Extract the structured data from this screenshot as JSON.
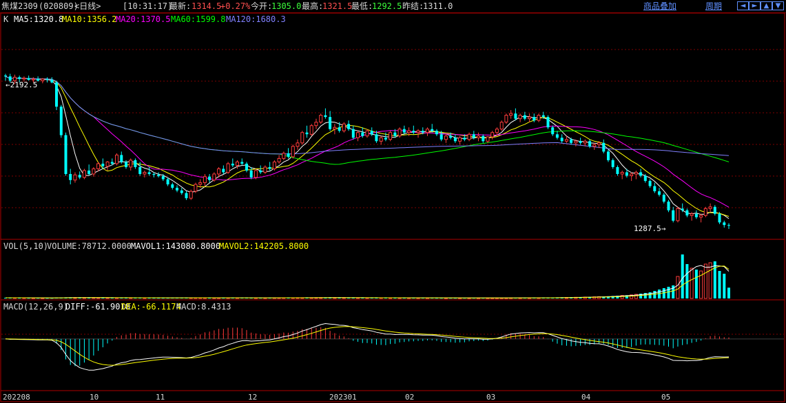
{
  "header": {
    "contract": "焦煤2309",
    "code": "(020809)",
    "period": "<日线>",
    "time": "[10:31:17]",
    "latest_label": "最新:",
    "latest": "1314.5",
    "change": "+0.27%",
    "open_label": "今开:",
    "open": "1305.0",
    "high_label": "最高:",
    "high": "1321.5",
    "low_label": "最低:",
    "low": "1292.5",
    "prev_close_label": "昨结:",
    "prev_close": "1311.0",
    "overlay_link": "商品叠加",
    "cycle_link": "周期",
    "nav_buttons": [
      "◄",
      "►",
      "▲",
      "▼"
    ]
  },
  "main_panel": {
    "type_label": "K",
    "ma": [
      {
        "label": "MA5:1320.8",
        "color": "#ffffff"
      },
      {
        "label": "MA10:1356.2",
        "color": "#ffff00"
      },
      {
        "label": "MA20:1370.5",
        "color": "#ff00ff"
      },
      {
        "label": "MA60:1599.8",
        "color": "#00ff00"
      },
      {
        "label": "MA120:1680.3",
        "color": "#8080ff"
      }
    ],
    "high_marker": "←2192.5",
    "low_marker": "1287.5→"
  },
  "vol_panel": {
    "title": "VOL(5,10)",
    "volume": "VOLUME:78712.0000",
    "mavol1": "MAVOL1:143080.8000",
    "mavol2": "MAVOL2:142205.8000"
  },
  "macd_panel": {
    "title": "MACD(12,26,9)",
    "diff": "DIFF:-61.9018",
    "dea": "DEA:-66.1174",
    "macd": "MACD:8.4313"
  },
  "x_axis_labels": [
    "202208",
    "10",
    "11",
    "12",
    "202301",
    "02",
    "03",
    "04",
    "05"
  ],
  "colors": {
    "up": "#ff3c3c",
    "down": "#00ffff",
    "grid": "#800000",
    "axis": "#b00000"
  },
  "chart_data": {
    "type": "candlestick",
    "price_range": [
      1240,
      2450
    ],
    "vol_range": [
      0,
      330000
    ],
    "macd_range": [
      -245,
      130
    ],
    "candles": [
      [
        2180,
        2190,
        2150,
        2175,
        5000
      ],
      [
        2175,
        2190,
        2140,
        2150,
        5200
      ],
      [
        2150,
        2185,
        2130,
        2170,
        4800
      ],
      [
        2170,
        2180,
        2140,
        2160,
        4500
      ],
      [
        2160,
        2175,
        2145,
        2165,
        4300
      ],
      [
        2165,
        2180,
        2150,
        2155,
        4100
      ],
      [
        2155,
        2170,
        2140,
        2160,
        4000
      ],
      [
        2160,
        2175,
        2145,
        2150,
        3900
      ],
      [
        2150,
        2165,
        2135,
        2160,
        3800
      ],
      [
        2160,
        2170,
        2140,
        2155,
        3700
      ],
      [
        2155,
        2170,
        2135,
        2140,
        3600
      ],
      [
        2140,
        2150,
        1980,
        2000,
        6000
      ],
      [
        2000,
        2010,
        1820,
        1835,
        6500
      ],
      [
        1835,
        1850,
        1600,
        1610,
        7000
      ],
      [
        1610,
        1640,
        1550,
        1575,
        6800
      ],
      [
        1575,
        1620,
        1560,
        1605,
        6400
      ],
      [
        1605,
        1625,
        1580,
        1590,
        6000
      ],
      [
        1590,
        1640,
        1580,
        1630,
        5800
      ],
      [
        1630,
        1665,
        1600,
        1610,
        5600
      ],
      [
        1610,
        1650,
        1595,
        1640,
        5500
      ],
      [
        1640,
        1680,
        1625,
        1670,
        5400
      ],
      [
        1670,
        1700,
        1640,
        1655,
        5300
      ],
      [
        1655,
        1685,
        1630,
        1680,
        5200
      ],
      [
        1680,
        1700,
        1660,
        1670,
        5100
      ],
      [
        1670,
        1730,
        1660,
        1720,
        5200
      ],
      [
        1720,
        1740,
        1670,
        1680,
        5300
      ],
      [
        1680,
        1690,
        1640,
        1650,
        5100
      ],
      [
        1650,
        1700,
        1630,
        1690,
        5000
      ],
      [
        1690,
        1700,
        1640,
        1650,
        4900
      ],
      [
        1650,
        1680,
        1600,
        1610,
        4800
      ],
      [
        1610,
        1630,
        1590,
        1620,
        4700
      ],
      [
        1620,
        1650,
        1600,
        1610,
        4600
      ],
      [
        1610,
        1620,
        1590,
        1605,
        4500
      ],
      [
        1605,
        1620,
        1590,
        1598,
        4400
      ],
      [
        1598,
        1610,
        1570,
        1580,
        4500
      ],
      [
        1580,
        1590,
        1540,
        1550,
        4700
      ],
      [
        1550,
        1560,
        1520,
        1530,
        4800
      ],
      [
        1530,
        1545,
        1505,
        1515,
        4900
      ],
      [
        1515,
        1530,
        1490,
        1500,
        5000
      ],
      [
        1500,
        1510,
        1460,
        1470,
        5100
      ],
      [
        1470,
        1520,
        1460,
        1510,
        5000
      ],
      [
        1510,
        1560,
        1500,
        1550,
        4900
      ],
      [
        1550,
        1580,
        1530,
        1560,
        4800
      ],
      [
        1560,
        1610,
        1540,
        1595,
        4700
      ],
      [
        1595,
        1610,
        1560,
        1575,
        4600
      ],
      [
        1575,
        1620,
        1565,
        1610,
        4600
      ],
      [
        1610,
        1650,
        1590,
        1640,
        4700
      ],
      [
        1640,
        1660,
        1610,
        1620,
        4700
      ],
      [
        1620,
        1680,
        1610,
        1670,
        4800
      ],
      [
        1670,
        1700,
        1650,
        1660,
        4800
      ],
      [
        1660,
        1690,
        1640,
        1680,
        4900
      ],
      [
        1680,
        1700,
        1660,
        1670,
        4900
      ],
      [
        1670,
        1680,
        1620,
        1630,
        4800
      ],
      [
        1630,
        1650,
        1580,
        1590,
        4700
      ],
      [
        1590,
        1640,
        1580,
        1630,
        4600
      ],
      [
        1630,
        1660,
        1610,
        1620,
        4600
      ],
      [
        1620,
        1660,
        1610,
        1650,
        4700
      ],
      [
        1650,
        1680,
        1630,
        1640,
        4700
      ],
      [
        1640,
        1690,
        1630,
        1680,
        4800
      ],
      [
        1680,
        1720,
        1670,
        1700,
        4900
      ],
      [
        1700,
        1740,
        1690,
        1730,
        5000
      ],
      [
        1730,
        1760,
        1700,
        1710,
        5100
      ],
      [
        1710,
        1780,
        1700,
        1770,
        5200
      ],
      [
        1770,
        1810,
        1750,
        1790,
        5300
      ],
      [
        1790,
        1860,
        1780,
        1850,
        5400
      ],
      [
        1850,
        1890,
        1820,
        1840,
        5500
      ],
      [
        1840,
        1900,
        1830,
        1890,
        5600
      ],
      [
        1890,
        1930,
        1870,
        1910,
        5700
      ],
      [
        1910,
        1960,
        1900,
        1950,
        5800
      ],
      [
        1950,
        1990,
        1930,
        1940,
        5900
      ],
      [
        1940,
        1975,
        1860,
        1870,
        6000
      ],
      [
        1870,
        1900,
        1840,
        1880,
        5800
      ],
      [
        1880,
        1910,
        1850,
        1860,
        5600
      ],
      [
        1860,
        1910,
        1850,
        1900,
        5500
      ],
      [
        1900,
        1920,
        1860,
        1870,
        5400
      ],
      [
        1870,
        1890,
        1810,
        1820,
        5300
      ],
      [
        1820,
        1860,
        1800,
        1850,
        5200
      ],
      [
        1850,
        1880,
        1820,
        1830,
        5100
      ],
      [
        1830,
        1870,
        1820,
        1860,
        5000
      ],
      [
        1860,
        1880,
        1830,
        1840,
        4900
      ],
      [
        1840,
        1860,
        1790,
        1800,
        4900
      ],
      [
        1800,
        1830,
        1780,
        1820,
        4800
      ],
      [
        1820,
        1850,
        1800,
        1810,
        4800
      ],
      [
        1810,
        1860,
        1800,
        1850,
        4700
      ],
      [
        1850,
        1870,
        1820,
        1830,
        4700
      ],
      [
        1830,
        1880,
        1820,
        1870,
        4600
      ],
      [
        1870,
        1890,
        1840,
        1850,
        4600
      ],
      [
        1850,
        1880,
        1830,
        1860,
        4500
      ],
      [
        1860,
        1890,
        1840,
        1850,
        4500
      ],
      [
        1850,
        1870,
        1820,
        1860,
        4400
      ],
      [
        1860,
        1880,
        1840,
        1850,
        4400
      ],
      [
        1850,
        1880,
        1830,
        1870,
        4300
      ],
      [
        1870,
        1900,
        1850,
        1860,
        4300
      ],
      [
        1860,
        1870,
        1830,
        1840,
        4200
      ],
      [
        1840,
        1860,
        1800,
        1810,
        4200
      ],
      [
        1810,
        1840,
        1790,
        1830,
        4100
      ],
      [
        1830,
        1850,
        1810,
        1820,
        4100
      ],
      [
        1820,
        1840,
        1790,
        1800,
        4000
      ],
      [
        1800,
        1830,
        1780,
        1820,
        4000
      ],
      [
        1820,
        1840,
        1800,
        1810,
        3900
      ],
      [
        1810,
        1850,
        1800,
        1840,
        3900
      ],
      [
        1840,
        1860,
        1810,
        1820,
        3800
      ],
      [
        1820,
        1850,
        1800,
        1830,
        3800
      ],
      [
        1830,
        1840,
        1790,
        1800,
        3800
      ],
      [
        1800,
        1830,
        1790,
        1825,
        3800
      ],
      [
        1825,
        1860,
        1810,
        1850,
        3900
      ],
      [
        1850,
        1880,
        1830,
        1870,
        4000
      ],
      [
        1870,
        1920,
        1860,
        1910,
        4100
      ],
      [
        1910,
        1960,
        1900,
        1950,
        4200
      ],
      [
        1950,
        1980,
        1930,
        1960,
        4300
      ],
      [
        1960,
        1990,
        1920,
        1930,
        4400
      ],
      [
        1930,
        1960,
        1910,
        1950,
        4500
      ],
      [
        1950,
        1970,
        1920,
        1930,
        4600
      ],
      [
        1930,
        1960,
        1910,
        1940,
        4700
      ],
      [
        1940,
        1960,
        1910,
        1920,
        4800
      ],
      [
        1920,
        1960,
        1910,
        1950,
        4900
      ],
      [
        1950,
        1970,
        1930,
        1940,
        5000
      ],
      [
        1940,
        1950,
        1870,
        1880,
        5500
      ],
      [
        1880,
        1890,
        1830,
        1840,
        6000
      ],
      [
        1840,
        1860,
        1810,
        1820,
        6500
      ],
      [
        1820,
        1840,
        1790,
        1800,
        7000
      ],
      [
        1800,
        1830,
        1790,
        1810,
        7500
      ],
      [
        1810,
        1820,
        1780,
        1790,
        8000
      ],
      [
        1790,
        1810,
        1770,
        1800,
        8500
      ],
      [
        1800,
        1820,
        1780,
        1790,
        9000
      ],
      [
        1790,
        1810,
        1770,
        1800,
        10000
      ],
      [
        1800,
        1810,
        1760,
        1770,
        11000
      ],
      [
        1770,
        1790,
        1750,
        1780,
        12000
      ],
      [
        1780,
        1800,
        1760,
        1790,
        13000
      ],
      [
        1790,
        1810,
        1730,
        1740,
        14000
      ],
      [
        1740,
        1750,
        1680,
        1690,
        16000
      ],
      [
        1690,
        1700,
        1640,
        1650,
        18000
      ],
      [
        1650,
        1660,
        1600,
        1610,
        20000
      ],
      [
        1610,
        1630,
        1580,
        1620,
        22000
      ],
      [
        1620,
        1640,
        1590,
        1600,
        24000
      ],
      [
        1600,
        1620,
        1570,
        1610,
        26000
      ],
      [
        1610,
        1630,
        1580,
        1620,
        30000
      ],
      [
        1620,
        1640,
        1590,
        1600,
        35000
      ],
      [
        1600,
        1610,
        1560,
        1570,
        40000
      ],
      [
        1570,
        1580,
        1530,
        1540,
        45000
      ],
      [
        1540,
        1560,
        1500,
        1510,
        55000
      ],
      [
        1510,
        1530,
        1480,
        1490,
        65000
      ],
      [
        1490,
        1500,
        1440,
        1450,
        75000
      ],
      [
        1450,
        1460,
        1390,
        1400,
        85000
      ],
      [
        1400,
        1420,
        1330,
        1340,
        95000
      ],
      [
        1340,
        1420,
        1330,
        1410,
        160000
      ],
      [
        1410,
        1440,
        1390,
        1400,
        320000
      ],
      [
        1400,
        1410,
        1360,
        1370,
        250000
      ],
      [
        1370,
        1390,
        1340,
        1380,
        220000
      ],
      [
        1380,
        1400,
        1350,
        1360,
        210000
      ],
      [
        1360,
        1380,
        1330,
        1370,
        200000
      ],
      [
        1370,
        1420,
        1360,
        1410,
        250000
      ],
      [
        1410,
        1440,
        1390,
        1420,
        260000
      ],
      [
        1420,
        1430,
        1370,
        1380,
        270000
      ],
      [
        1380,
        1390,
        1320,
        1330,
        200000
      ],
      [
        1330,
        1340,
        1300,
        1315,
        180000
      ],
      [
        1315,
        1325,
        1292,
        1314,
        78712
      ]
    ]
  }
}
